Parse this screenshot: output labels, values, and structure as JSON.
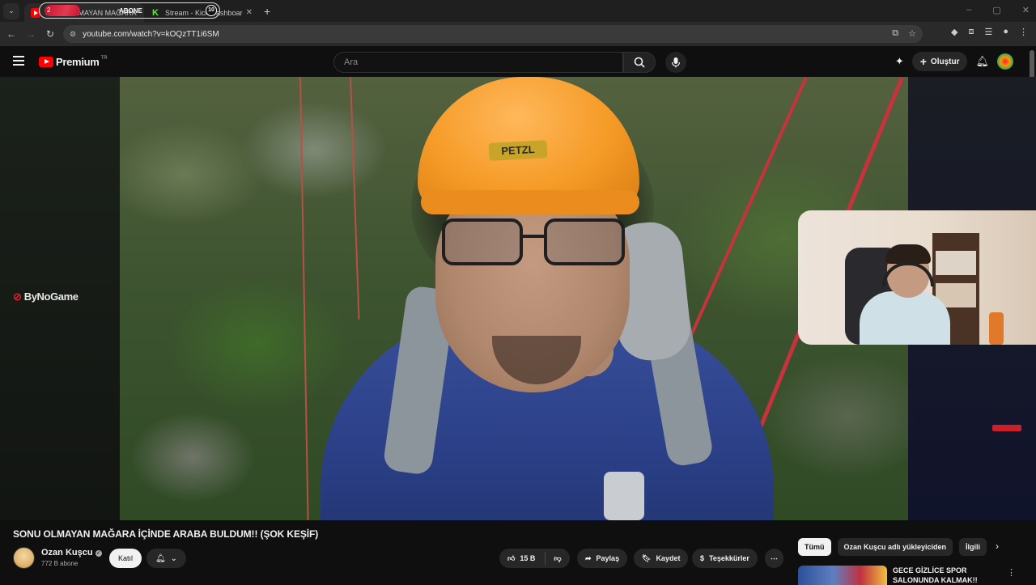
{
  "browser": {
    "tabs": [
      {
        "title": "SONU OLMAYAN MAĞARA",
        "active": true
      },
      {
        "title": "Stream - Kick Dashboard",
        "active": false
      }
    ],
    "overlay": {
      "badge": "2",
      "label": "ABONE",
      "count": "10"
    },
    "url": "youtube.com/watch?v=kOQzTT1i6SM"
  },
  "masthead": {
    "logo_text": "Premium",
    "country": "TR",
    "search_placeholder": "Ara",
    "create_label": "Oluştur"
  },
  "stream": {
    "brand": "ByNoGame",
    "helmet_text": "PETZL"
  },
  "video": {
    "title": "SONU OLMAYAN MAĞARA İÇİNDE ARABA BULDUM!! (ŞOK KEŞİF)",
    "channel": "Ozan Kuşcu",
    "subscribers": "772 B abone",
    "join_label": "Katıl",
    "likes": "15 B",
    "share_label": "Paylaş",
    "save_label": "Kaydet",
    "thanks_label": "Teşekkürler"
  },
  "chips": [
    "Tümü",
    "Ozan Kuşcu adlı yükleyiciden",
    "İlgili"
  ],
  "recommendation": {
    "title": "GECE GİZLİCE SPOR SALONUNDA KALMAK!!"
  },
  "colors": {
    "background": "#0f0f0f",
    "youtube_red": "#ff0000",
    "pill": "#272727",
    "kick_green": "#53fc18"
  }
}
